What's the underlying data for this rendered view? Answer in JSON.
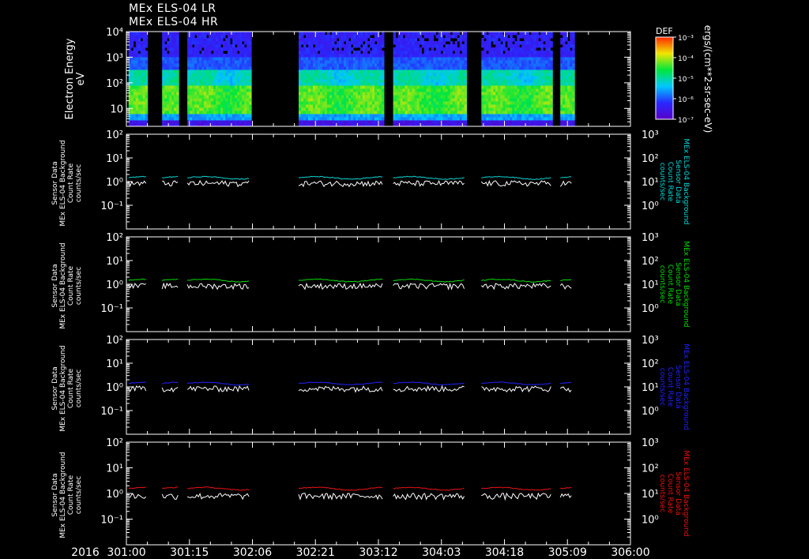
{
  "titles": [
    "MEx ELS-04 LR",
    "MEx ELS-04 HR"
  ],
  "chart_data": [
    {
      "type": "heatmap",
      "ylabel": [
        "Electron Energy",
        "eV"
      ],
      "ylim": [
        2,
        10000
      ],
      "yscale": "log",
      "yticks": [
        {
          "v": 10,
          "t": "10"
        },
        {
          "v": 100,
          "t": "10²"
        },
        {
          "v": 1000,
          "t": "10³"
        },
        {
          "v": 10000,
          "t": "10⁴"
        }
      ],
      "colorbar": {
        "label": "DEF",
        "units": "ergs/(cm**2-sr-sec-eV)",
        "ticks": [
          "10⁻³",
          "10⁻⁴",
          "10⁻⁵",
          "10⁻⁶",
          "10⁻⁷"
        ]
      }
    },
    {
      "type": "line",
      "ylabel_left": [
        "Sensor Data",
        "MEx ELS-04 Background",
        "Count Rate",
        "counts/sec"
      ],
      "ylabel_right": [
        "MEx ELS-04 Background",
        "Sensor Data",
        "Count Rate",
        "counts/sec"
      ],
      "ylim": [
        0.01,
        100
      ],
      "yscale": "log",
      "yticks": [
        "10⁻¹",
        "10⁰",
        "10¹",
        "10²"
      ],
      "y2ticks": [
        "10⁰",
        "10¹",
        "10²",
        "10³"
      ],
      "series": [
        {
          "color": "#00d8d8",
          "level": 1.45
        },
        {
          "color": "#ffffff",
          "level": 0.85
        }
      ]
    },
    {
      "type": "line",
      "ylabel_left": [
        "Sensor Data",
        "MEx ELS-04 Background",
        "Count Rate",
        "counts/sec"
      ],
      "ylabel_right": [
        "MEx ELS-04 Background",
        "Sensor Data",
        "Count Rate",
        "counts/sec"
      ],
      "ylim": [
        0.01,
        100
      ],
      "yscale": "log",
      "yticks": [
        "10⁻¹",
        "10⁰",
        "10¹",
        "10²"
      ],
      "y2ticks": [
        "10⁰",
        "10¹",
        "10²",
        "10³"
      ],
      "series": [
        {
          "color": "#00dd00",
          "level": 1.45
        },
        {
          "color": "#ffffff",
          "level": 0.85
        }
      ]
    },
    {
      "type": "line",
      "ylabel_left": [
        "Sensor Data",
        "MEx ELS-04 Background",
        "Count Rate",
        "counts/sec"
      ],
      "ylabel_right": [
        "MEx ELS-04 Background",
        "Sensor Data",
        "Count Rate",
        "counts/sec"
      ],
      "ylim": [
        0.01,
        100
      ],
      "yscale": "log",
      "yticks": [
        "10⁻¹",
        "10⁰",
        "10¹",
        "10²"
      ],
      "y2ticks": [
        "10⁰",
        "10¹",
        "10²",
        "10³"
      ],
      "series": [
        {
          "color": "#2222ff",
          "level": 1.4
        },
        {
          "color": "#ffffff",
          "level": 0.85
        }
      ]
    },
    {
      "type": "line",
      "ylabel_left": [
        "Sensor Data",
        "MEx ELS-04 Background",
        "Count Rate",
        "counts/sec"
      ],
      "ylabel_right": [
        "MEx ELS-04 Background",
        "Sensor Data",
        "Count Rate",
        "counts/sec"
      ],
      "ylim": [
        0.01,
        100
      ],
      "yscale": "log",
      "yticks": [
        "10⁻¹",
        "10⁰",
        "10¹",
        "10²"
      ],
      "y2ticks": [
        "10⁰",
        "10¹",
        "10²",
        "10³"
      ],
      "series": [
        {
          "color": "#ee1111",
          "level": 1.55
        },
        {
          "color": "#ffffff",
          "level": 0.8
        }
      ]
    }
  ],
  "xaxis": {
    "year": "2016",
    "range": [
      0,
      120
    ],
    "ticks": [
      {
        "x": 0,
        "t": "301:00"
      },
      {
        "x": 15,
        "t": "301:15"
      },
      {
        "x": 30,
        "t": "302:06"
      },
      {
        "x": 45,
        "t": "302:21"
      },
      {
        "x": 60,
        "t": "303:12"
      },
      {
        "x": 75,
        "t": "304:03"
      },
      {
        "x": 90,
        "t": "304:18"
      },
      {
        "x": 105,
        "t": "305:09"
      },
      {
        "x": 120,
        "t": "306:00"
      }
    ],
    "data_intervals": [
      [
        0.5,
        5.0
      ],
      [
        8.5,
        12.3
      ],
      [
        14.5,
        29.5
      ],
      [
        41.0,
        61.3
      ],
      [
        63.5,
        80.5
      ],
      [
        84.5,
        101.3
      ],
      [
        103.3,
        106.3
      ]
    ]
  }
}
